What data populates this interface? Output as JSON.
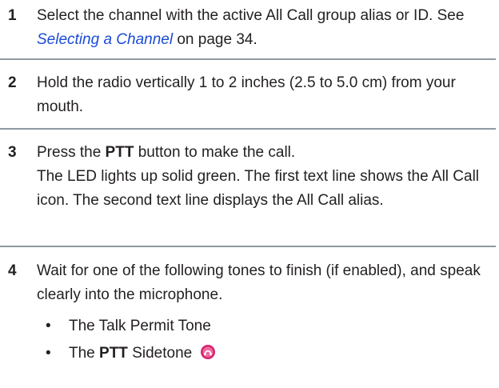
{
  "steps": [
    {
      "num": "1",
      "text_a": "Select the channel with the active All Call group alias or ID. See ",
      "link": "Selecting a Channel",
      "text_b": " on page 34."
    },
    {
      "num": "2",
      "text": "Hold the radio vertically 1 to 2 inches (2.5 to 5.0 cm) from your mouth."
    },
    {
      "num": "3",
      "text_a": "Press the ",
      "bold": "PTT",
      "text_b": " button to make the call.",
      "detail": "The LED lights up solid green. The first text line shows the All Call icon. The second text line displays the All Call alias."
    },
    {
      "num": "4",
      "text": "Wait for one of the following tones to finish (if enabled), and speak clearly into the microphone.",
      "bullets": [
        {
          "text": "The Talk Permit Tone"
        },
        {
          "text_a": "The ",
          "bold": "PTT",
          "text_b": " Sidetone",
          "icon": "ptt-sidetone-icon"
        }
      ]
    }
  ],
  "icon_color": "#d6246e"
}
